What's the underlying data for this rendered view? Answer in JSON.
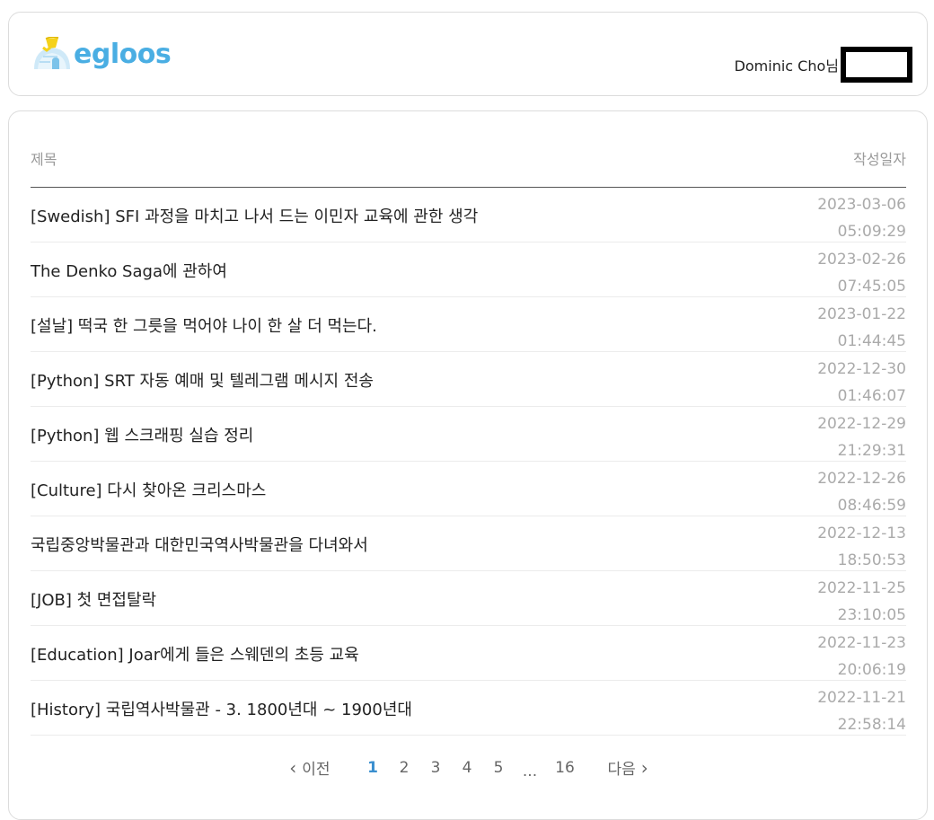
{
  "header": {
    "logo_text": "egloos",
    "user_name": "Dominic Cho님"
  },
  "table": {
    "col_title": "제목",
    "col_date": "작성일자",
    "rows": [
      {
        "title": "[Swedish] SFI 과정을 마치고 나서 드는 이민자 교육에 관한 생각",
        "date": "2023-03-06",
        "time": "05:09:29"
      },
      {
        "title": "The Denko Saga에 관하여",
        "date": "2023-02-26",
        "time": "07:45:05"
      },
      {
        "title": "[설날] 떡국 한 그릇을 먹어야 나이 한 살 더 먹는다.",
        "date": "2023-01-22",
        "time": "01:44:45"
      },
      {
        "title": "[Python] SRT 자동 예매 및 텔레그램 메시지 전송",
        "date": "2022-12-30",
        "time": "01:46:07"
      },
      {
        "title": "[Python] 웹 스크래핑 실습 정리",
        "date": "2022-12-29",
        "time": "21:29:31"
      },
      {
        "title": "[Culture] 다시 찾아온 크리스마스",
        "date": "2022-12-26",
        "time": "08:46:59"
      },
      {
        "title": "국립중앙박물관과 대한민국역사박물관을 다녀와서",
        "date": "2022-12-13",
        "time": "18:50:53"
      },
      {
        "title": "[JOB] 첫 면접탈락",
        "date": "2022-11-25",
        "time": "23:10:05"
      },
      {
        "title": "[Education] Joar에게 들은 스웨덴의 초등 교육",
        "date": "2022-11-23",
        "time": "20:06:19"
      },
      {
        "title": "[History] 국립역사박물관 - 3. 1800년대 ~ 1900년대",
        "date": "2022-11-21",
        "time": "22:58:14"
      }
    ]
  },
  "pagination": {
    "prev_label": "이전",
    "next_label": "다음",
    "pages": [
      "1",
      "2",
      "3",
      "4",
      "5"
    ],
    "current_page": "1",
    "ellipsis": "...",
    "last_page": "16"
  },
  "colors": {
    "brand": "#4aaee3",
    "current_page": "#3a8fcf",
    "muted": "#aaaaaa"
  },
  "icons": {
    "logo": "egloos-igloo-logo",
    "prev": "chevron-left-icon",
    "next": "chevron-right-icon"
  }
}
